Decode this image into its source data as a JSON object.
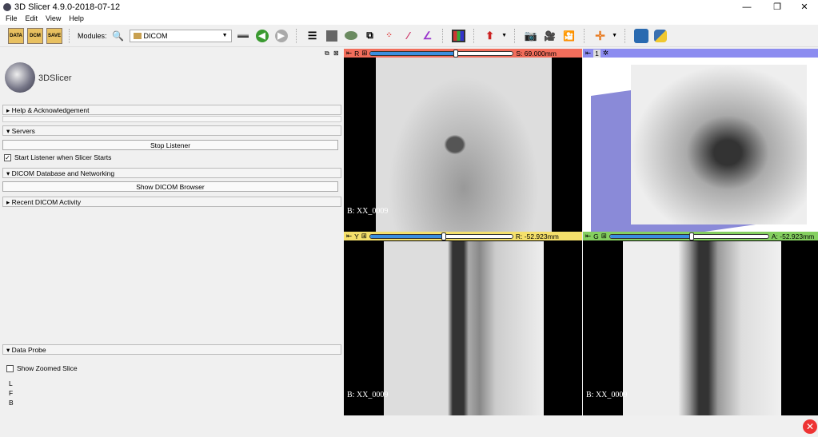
{
  "window": {
    "title": "3D Slicer 4.9.0-2018-07-12",
    "minimize": "—",
    "maximize": "❐",
    "close": "✕"
  },
  "menu": [
    "File",
    "Edit",
    "View",
    "Help"
  ],
  "toolbar": {
    "data": "DATA",
    "dcm": "DCM",
    "save": "SAVE",
    "modules_label": "Modules:",
    "module_selected": "DICOM"
  },
  "logo": "3DSlicer",
  "panels": {
    "help": "Help & Acknowledgement",
    "servers": "Servers",
    "stop_listener": "Stop Listener",
    "start_listener": "Start Listener when Slicer Starts",
    "start_listener_checked": true,
    "dicom_db": "DICOM Database and Networking",
    "show_browser": "Show DICOM Browser",
    "recent": "Recent DICOM Activity",
    "data_probe": "Data Probe",
    "show_zoomed": "Show Zoomed Slice",
    "probe_rows": [
      "L",
      "F",
      "B"
    ]
  },
  "views": {
    "red": {
      "letter": "R",
      "offset": "S: 69.000mm",
      "slider": 0.5,
      "label": "B: XX_0009",
      "color": "#f26d5b"
    },
    "threed": {
      "letter": "1",
      "color": "#8c8cf0"
    },
    "yellow": {
      "letter": "Y",
      "offset": "R: -52.923mm",
      "slider": 0.5,
      "label": "B: XX_0009",
      "color": "#f5e06b"
    },
    "green": {
      "letter": "G",
      "offset": "A: -52.923mm",
      "slider": 0.5,
      "label": "B: XX_0009",
      "color": "#85d060"
    }
  }
}
